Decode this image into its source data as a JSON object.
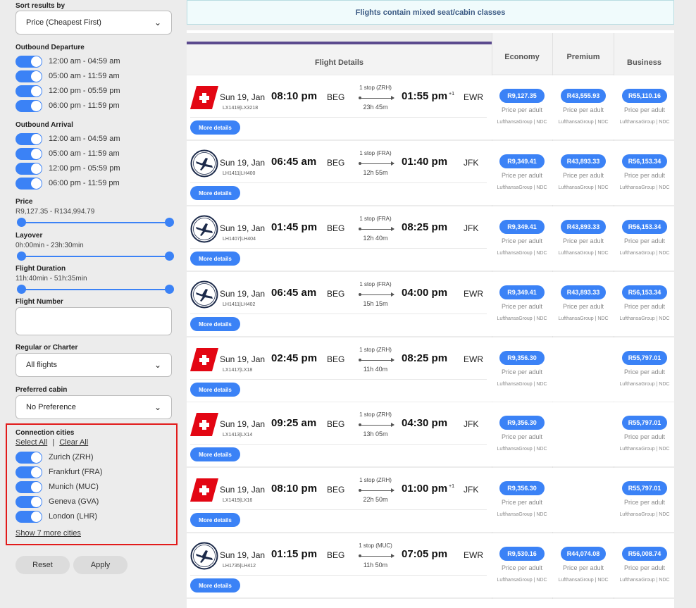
{
  "sidebar": {
    "sort": {
      "label": "Sort results by",
      "value": "Price (Cheapest First)"
    },
    "outbound_departure": {
      "label": "Outbound Departure",
      "options": [
        "12:00 am - 04:59 am",
        "05:00 am - 11:59 am",
        "12:00 pm - 05:59 pm",
        "06:00 pm - 11:59 pm"
      ]
    },
    "outbound_arrival": {
      "label": "Outbound Arrival",
      "options": [
        "12:00 am - 04:59 am",
        "05:00 am - 11:59 am",
        "12:00 pm - 05:59 pm",
        "06:00 pm - 11:59 pm"
      ]
    },
    "price": {
      "label": "Price",
      "range": "R9,127.35 - R134,994.79"
    },
    "layover": {
      "label": "Layover",
      "range": "0h:00min - 23h:30min"
    },
    "flight_duration": {
      "label": "Flight Duration",
      "range": "11h:40min - 51h:35min"
    },
    "flight_number": {
      "label": "Flight Number",
      "value": ""
    },
    "regular_charter": {
      "label": "Regular or Charter",
      "value": "All flights"
    },
    "preferred_cabin": {
      "label": "Preferred cabin",
      "value": "No Preference"
    },
    "connection_cities": {
      "label": "Connection cities",
      "select_all": "Select All",
      "separator": "|",
      "clear_all": "Clear All",
      "cities": [
        "Zurich (ZRH)",
        "Frankfurt (FRA)",
        "Munich (MUC)",
        "Geneva (GVA)",
        "London (LHR)"
      ],
      "show_more": "Show 7 more cities"
    },
    "reset": "Reset",
    "apply": "Apply",
    "accent": "#3b82f6",
    "highlight": "#e21b1b"
  },
  "main": {
    "notice": "Flights contain mixed seat/cabin classes",
    "columns": {
      "details": "Flight Details",
      "economy": "Economy",
      "premium": "Premium",
      "business": "Business"
    },
    "more_details": "More details",
    "price_per_adult": "Price per adult",
    "source": "LufthansaGroup | NDC",
    "flights": [
      {
        "airline": "swiss",
        "date": "Sun 19, Jan",
        "flight_no": "LX1419|LX3218",
        "dep": "08:10 pm",
        "from": "BEG",
        "stops": "1 stop (ZRH)",
        "duration": "23h 45m",
        "arr": "01:55 pm",
        "plus": "+1",
        "to": "EWR",
        "economy": "R9,127.35",
        "premium": "R43,555.93",
        "business": "R55,110.16"
      },
      {
        "airline": "lufthansa",
        "date": "Sun 19, Jan",
        "flight_no": "LH1411|LH400",
        "dep": "06:45 am",
        "from": "BEG",
        "stops": "1 stop (FRA)",
        "duration": "12h 55m",
        "arr": "01:40 pm",
        "plus": "",
        "to": "JFK",
        "economy": "R9,349.41",
        "premium": "R43,893.33",
        "business": "R56,153.34"
      },
      {
        "airline": "lufthansa",
        "date": "Sun 19, Jan",
        "flight_no": "LH1407|LH404",
        "dep": "01:45 pm",
        "from": "BEG",
        "stops": "1 stop (FRA)",
        "duration": "12h 40m",
        "arr": "08:25 pm",
        "plus": "",
        "to": "JFK",
        "economy": "R9,349.41",
        "premium": "R43,893.33",
        "business": "R56,153.34"
      },
      {
        "airline": "lufthansa",
        "date": "Sun 19, Jan",
        "flight_no": "LH1411|LH402",
        "dep": "06:45 am",
        "from": "BEG",
        "stops": "1 stop (FRA)",
        "duration": "15h 15m",
        "arr": "04:00 pm",
        "plus": "",
        "to": "EWR",
        "economy": "R9,349.41",
        "premium": "R43,893.33",
        "business": "R56,153.34"
      },
      {
        "airline": "swiss",
        "date": "Sun 19, Jan",
        "flight_no": "LX1417|LX18",
        "dep": "02:45 pm",
        "from": "BEG",
        "stops": "1 stop (ZRH)",
        "duration": "11h 40m",
        "arr": "08:25 pm",
        "plus": "",
        "to": "EWR",
        "economy": "R9,356.30",
        "premium": "",
        "business": "R55,797.01"
      },
      {
        "airline": "swiss",
        "date": "Sun 19, Jan",
        "flight_no": "LX1413|LX14",
        "dep": "09:25 am",
        "from": "BEG",
        "stops": "1 stop (ZRH)",
        "duration": "13h 05m",
        "arr": "04:30 pm",
        "plus": "",
        "to": "JFK",
        "economy": "R9,356.30",
        "premium": "",
        "business": "R55,797.01"
      },
      {
        "airline": "swiss",
        "date": "Sun 19, Jan",
        "flight_no": "LX1419|LX16",
        "dep": "08:10 pm",
        "from": "BEG",
        "stops": "1 stop (ZRH)",
        "duration": "22h 50m",
        "arr": "01:00 pm",
        "plus": "+1",
        "to": "JFK",
        "economy": "R9,356.30",
        "premium": "",
        "business": "R55,797.01"
      },
      {
        "airline": "lufthansa",
        "date": "Sun 19, Jan",
        "flight_no": "LH1735|LH412",
        "dep": "01:15 pm",
        "from": "BEG",
        "stops": "1 stop (MUC)",
        "duration": "11h 50m",
        "arr": "07:05 pm",
        "plus": "",
        "to": "EWR",
        "economy": "R9,530.16",
        "premium": "R44,074.08",
        "business": "R56,008.74"
      }
    ]
  }
}
